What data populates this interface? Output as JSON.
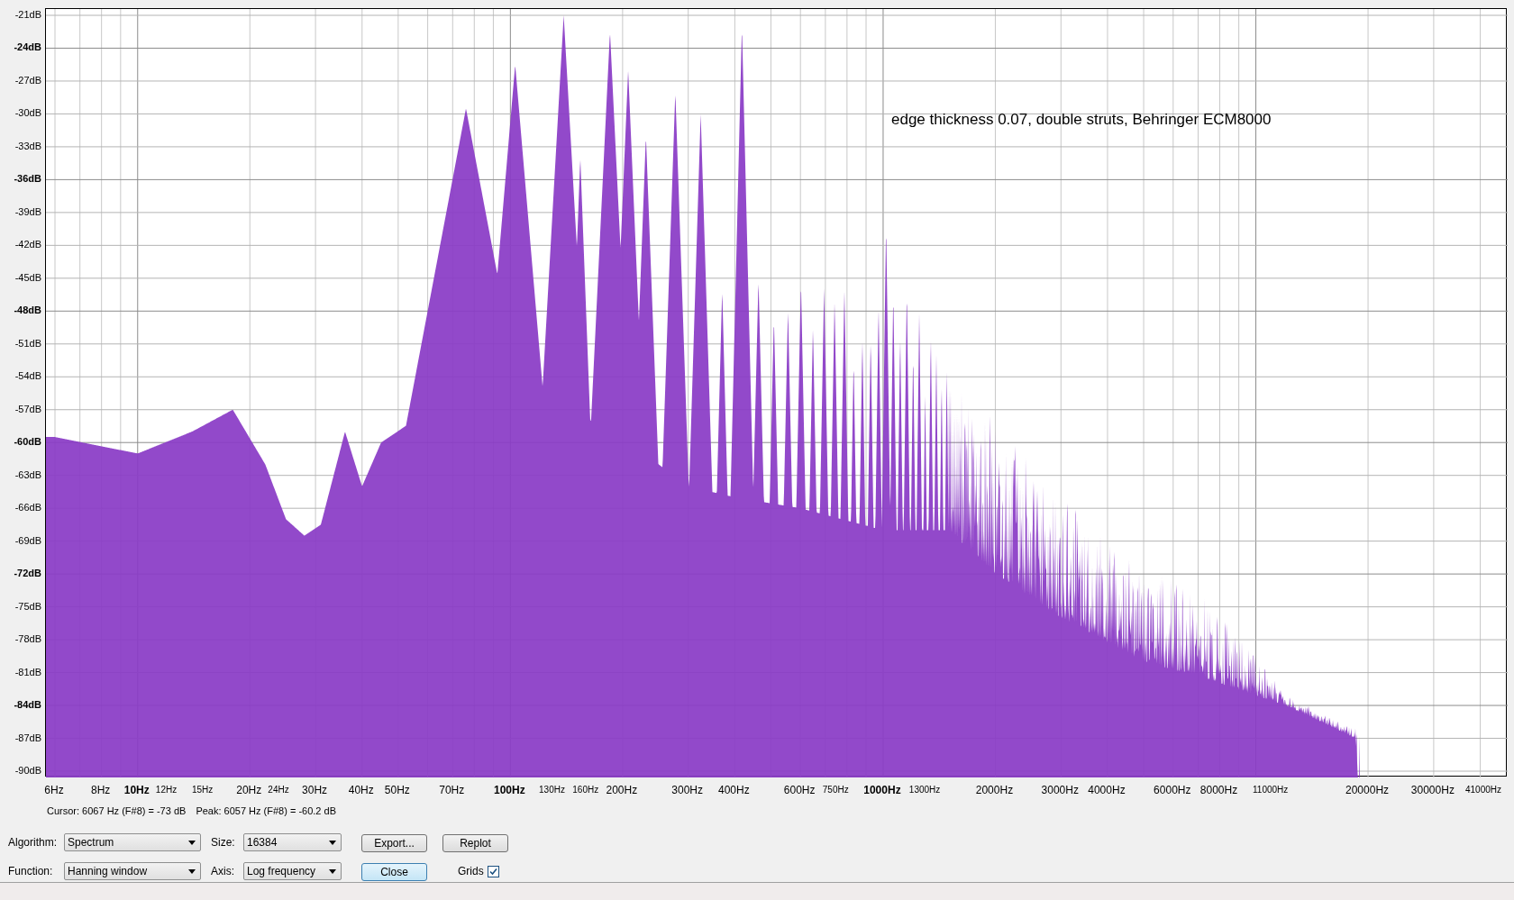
{
  "y_axis": {
    "labels": [
      {
        "text": "-21dB",
        "bold": false
      },
      {
        "text": "-24dB",
        "bold": true
      },
      {
        "text": "-27dB",
        "bold": false
      },
      {
        "text": "-30dB",
        "bold": false
      },
      {
        "text": "-33dB",
        "bold": false
      },
      {
        "text": "-36dB",
        "bold": true
      },
      {
        "text": "-39dB",
        "bold": false
      },
      {
        "text": "-42dB",
        "bold": false
      },
      {
        "text": "-45dB",
        "bold": false
      },
      {
        "text": "-48dB",
        "bold": true
      },
      {
        "text": "-51dB",
        "bold": false
      },
      {
        "text": "-54dB",
        "bold": false
      },
      {
        "text": "-57dB",
        "bold": false
      },
      {
        "text": "-60dB",
        "bold": true
      },
      {
        "text": "-63dB",
        "bold": false
      },
      {
        "text": "-66dB",
        "bold": false
      },
      {
        "text": "-69dB",
        "bold": false
      },
      {
        "text": "-72dB",
        "bold": true
      },
      {
        "text": "-75dB",
        "bold": false
      },
      {
        "text": "-78dB",
        "bold": false
      },
      {
        "text": "-81dB",
        "bold": false
      },
      {
        "text": "-84dB",
        "bold": true
      },
      {
        "text": "-87dB",
        "bold": false
      },
      {
        "text": "-90dB",
        "bold": false
      }
    ]
  },
  "x_axis": {
    "labels": [
      {
        "text": "6Hz",
        "bold": false,
        "small": false
      },
      {
        "text": "8Hz",
        "bold": false,
        "small": false
      },
      {
        "text": "10Hz",
        "bold": true,
        "small": false
      },
      {
        "text": "12Hz",
        "bold": false,
        "small": true
      },
      {
        "text": "15Hz",
        "bold": false,
        "small": true
      },
      {
        "text": "20Hz",
        "bold": false,
        "small": false
      },
      {
        "text": "24Hz",
        "bold": false,
        "small": true
      },
      {
        "text": "30Hz",
        "bold": false,
        "small": false
      },
      {
        "text": "40Hz",
        "bold": false,
        "small": false
      },
      {
        "text": "50Hz",
        "bold": false,
        "small": false
      },
      {
        "text": "70Hz",
        "bold": false,
        "small": false
      },
      {
        "text": "100Hz",
        "bold": true,
        "small": false
      },
      {
        "text": "130Hz",
        "bold": false,
        "small": true
      },
      {
        "text": "160Hz",
        "bold": false,
        "small": true
      },
      {
        "text": "200Hz",
        "bold": false,
        "small": false
      },
      {
        "text": "300Hz",
        "bold": false,
        "small": false
      },
      {
        "text": "400Hz",
        "bold": false,
        "small": false
      },
      {
        "text": "600Hz",
        "bold": false,
        "small": false
      },
      {
        "text": "750Hz",
        "bold": false,
        "small": true
      },
      {
        "text": "1000Hz",
        "bold": true,
        "small": false
      },
      {
        "text": "1300Hz",
        "bold": false,
        "small": true
      },
      {
        "text": "2000Hz",
        "bold": false,
        "small": false
      },
      {
        "text": "3000Hz",
        "bold": false,
        "small": false
      },
      {
        "text": "4000Hz",
        "bold": false,
        "small": false
      },
      {
        "text": "6000Hz",
        "bold": false,
        "small": false
      },
      {
        "text": "8000Hz",
        "bold": false,
        "small": false
      },
      {
        "text": "11000Hz",
        "bold": false,
        "small": true
      },
      {
        "text": "20000Hz",
        "bold": false,
        "small": false
      },
      {
        "text": "30000Hz",
        "bold": false,
        "small": false
      },
      {
        "text": "41000Hz",
        "bold": false,
        "small": true
      }
    ]
  },
  "annotation": "edge thickness 0.07, double struts, Behringer ECM8000",
  "readout": [
    "Cursor: 6067 Hz (F#8) = -73 dB",
    "Peak: 6057 Hz (F#8) = -60.2 dB"
  ],
  "controls": [
    [
      {
        "kind": "select",
        "label": "Algorithm:",
        "value": "Spectrum"
      },
      {
        "kind": "select",
        "label": "Size:",
        "value": "16384"
      },
      {
        "kind": "button",
        "label": "Export...",
        "focused": false
      },
      {
        "kind": "button",
        "label": "Replot",
        "focused": false
      }
    ],
    [
      {
        "kind": "select",
        "label": "Function:",
        "value": "Hanning window"
      },
      {
        "kind": "select",
        "label": "Axis:",
        "value": "Log frequency"
      },
      {
        "kind": "button",
        "label": "Close",
        "focused": true
      },
      {
        "kind": "checkbox",
        "label": "Grids",
        "checked": true
      }
    ]
  ]
}
